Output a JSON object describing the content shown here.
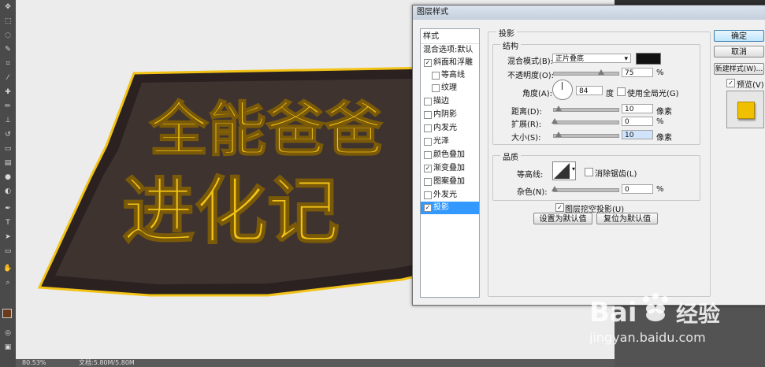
{
  "dialog": {
    "title": "图层样式",
    "styles_list_header": "样式",
    "blending_options": "混合选项:默认",
    "styles": [
      {
        "label": "斜面和浮雕",
        "checked": true
      },
      {
        "label": "等高线",
        "checked": false
      },
      {
        "label": "纹理",
        "checked": false
      },
      {
        "label": "描边",
        "checked": false
      },
      {
        "label": "内阴影",
        "checked": false
      },
      {
        "label": "内发光",
        "checked": false
      },
      {
        "label": "光泽",
        "checked": false
      },
      {
        "label": "颜色叠加",
        "checked": false
      },
      {
        "label": "渐变叠加",
        "checked": true
      },
      {
        "label": "图案叠加",
        "checked": false
      },
      {
        "label": "外发光",
        "checked": false
      },
      {
        "label": "投影",
        "checked": true
      }
    ],
    "drop_shadow": {
      "section_title": "投影",
      "structure_title": "结构",
      "blend_mode_label": "混合模式(B):",
      "blend_mode_value": "正片叠底",
      "shadow_color": "#111111",
      "opacity_label": "不透明度(O):",
      "opacity_value": "75",
      "percent": "%",
      "angle_label": "角度(A):",
      "angle_value": "84",
      "degree_unit": "度",
      "global_light_label": "使用全局光(G)",
      "distance_label": "距离(D):",
      "distance_value": "10",
      "pixel_unit": "像素",
      "spread_label": "扩展(R):",
      "spread_value": "0",
      "size_label": "大小(S):",
      "size_value": "10",
      "quality_title": "品质",
      "contour_label": "等高线:",
      "antialias_label": "消除锯齿(L)",
      "noise_label": "杂色(N):",
      "noise_value": "0",
      "knockout_label": "图层挖空投影(U)",
      "make_default_label": "设置为默认值",
      "reset_default_label": "复位为默认值"
    },
    "buttons": {
      "ok": "确定",
      "cancel": "取消",
      "new_style": "新建样式(W)...",
      "preview": "预览(V)"
    },
    "preview_swatch_color": "#f0c000"
  },
  "canvas": {
    "logo_line1": "全能爸爸",
    "logo_line2": "进化记",
    "logo_gold": "#f2c316",
    "logo_dark": "#3f3330"
  },
  "status": {
    "zoom": "80.53%",
    "doc": "文档:5.80M/5.80M"
  },
  "watermark": {
    "brand": "Bai",
    "brand2": "经验",
    "url": "jingyan.baidu.com"
  }
}
